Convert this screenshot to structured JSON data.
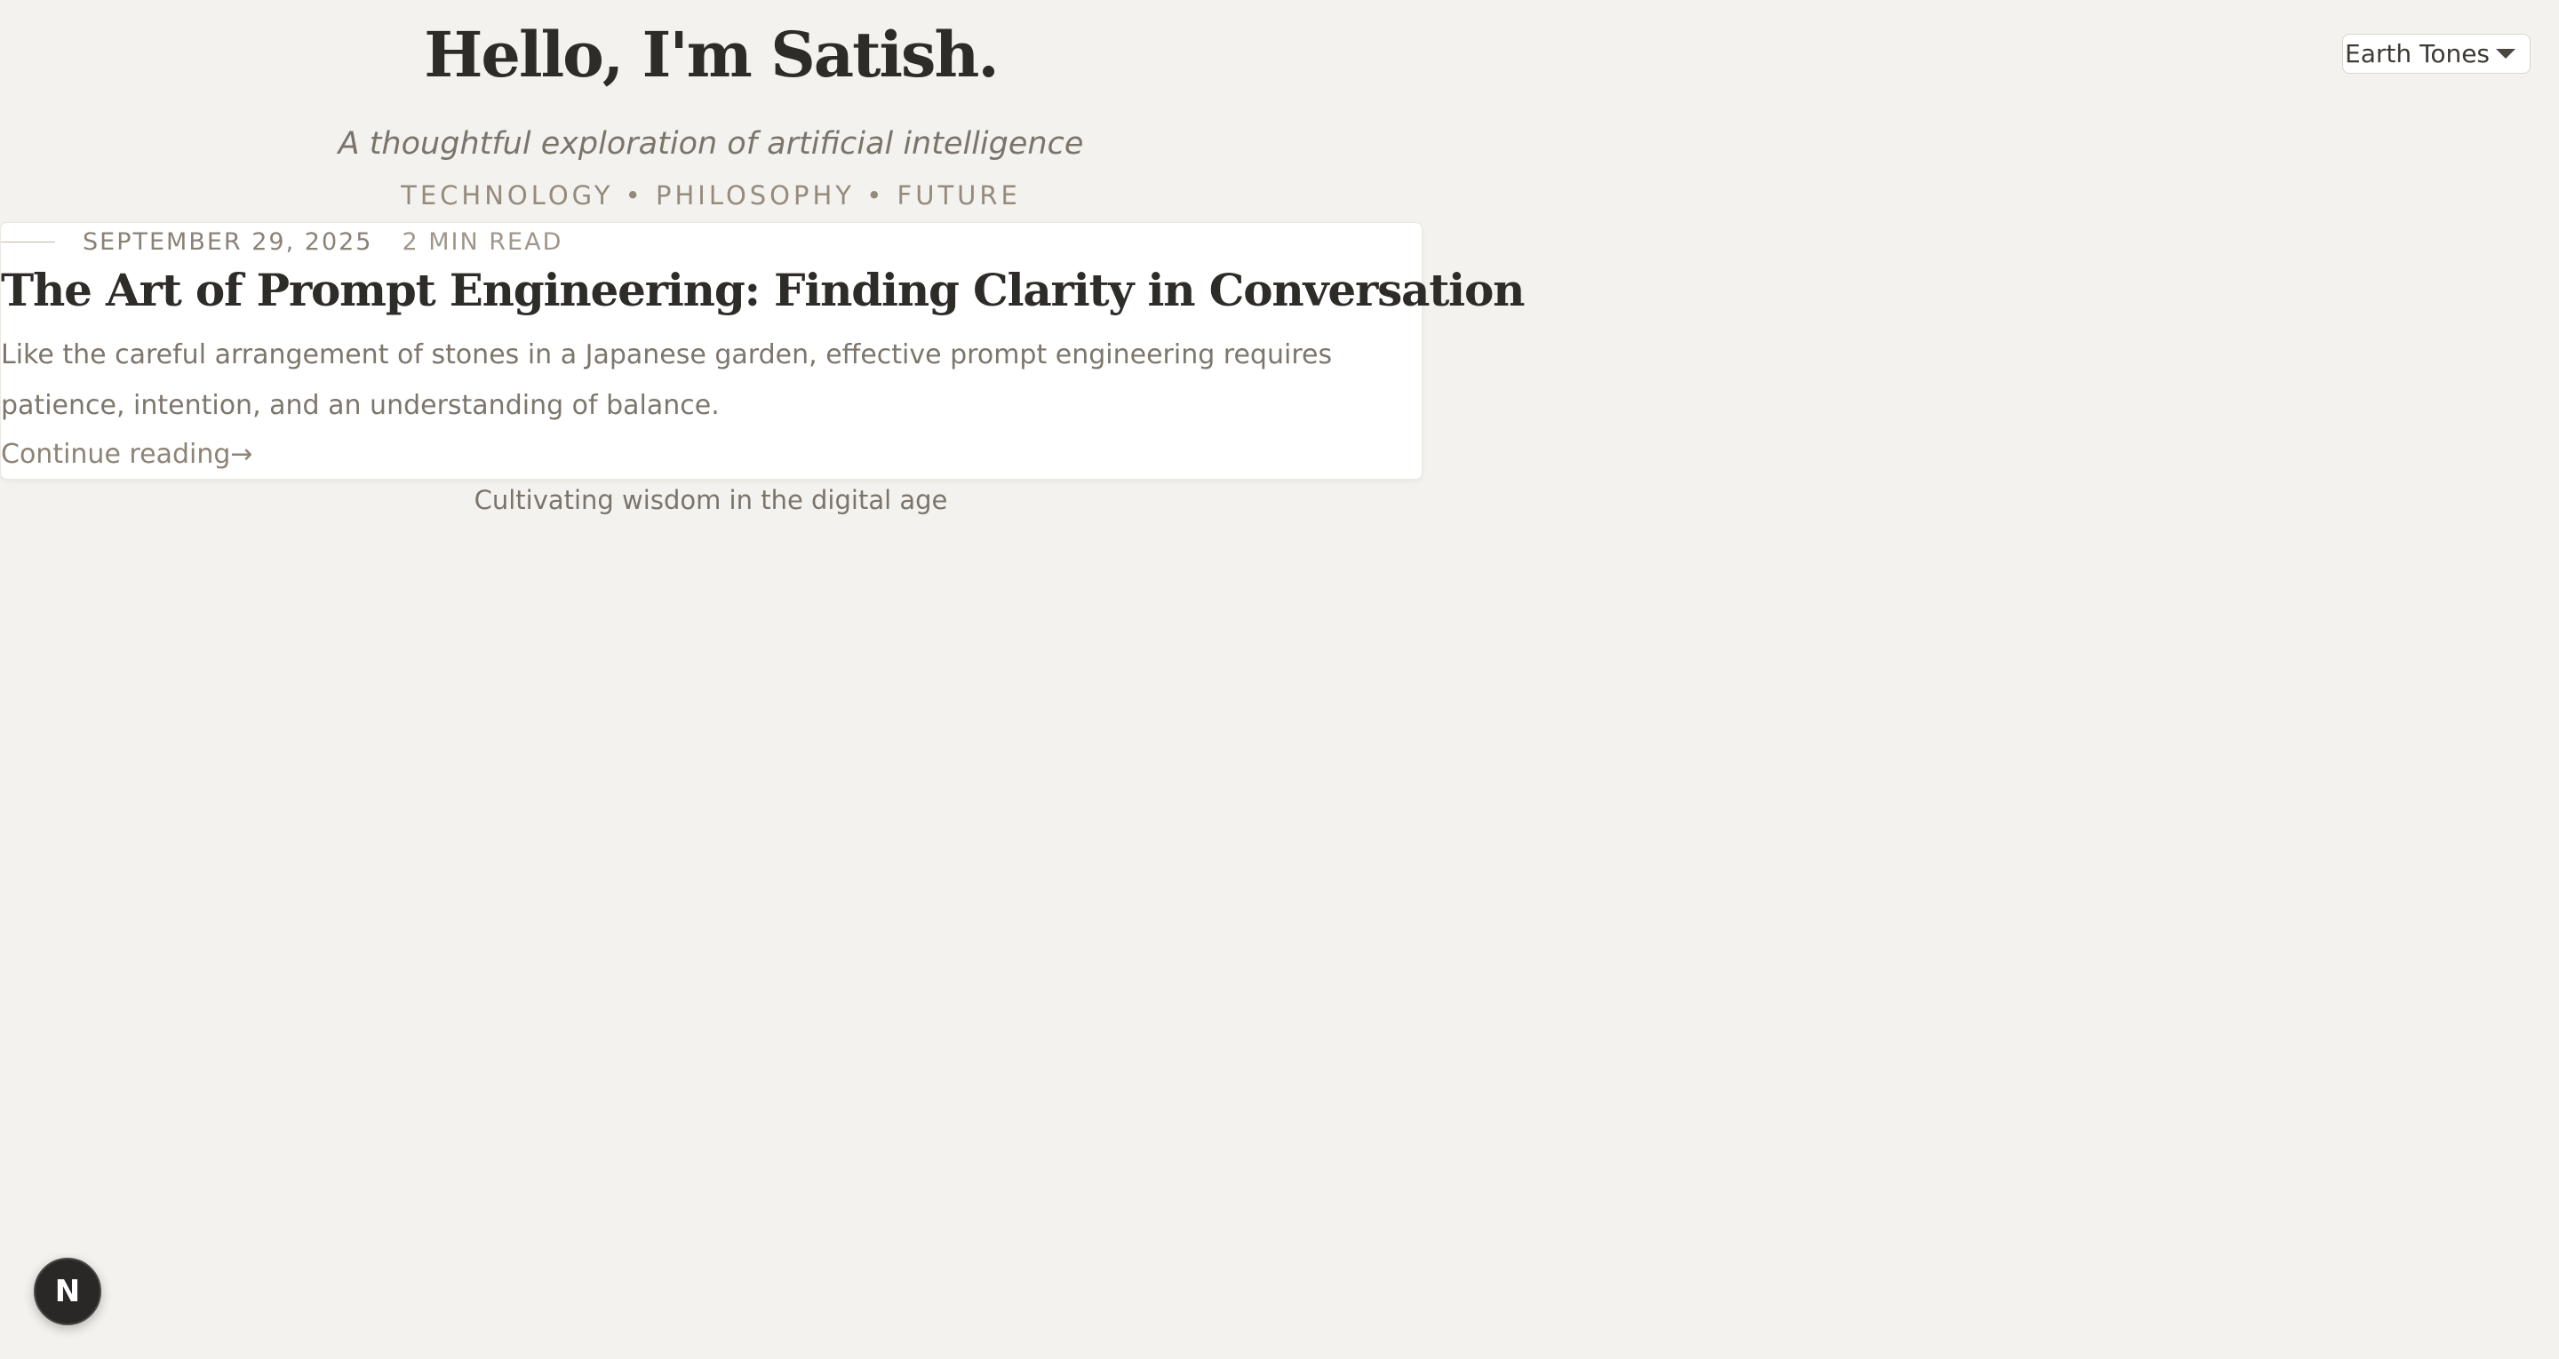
{
  "theme_selector": {
    "selected": "Earth Tones",
    "icon": "chevron-down-icon"
  },
  "header": {
    "title": "Hello, I'm Satish.",
    "tagline": "A thoughtful exploration of artificial intelligence",
    "topics": "TECHNOLOGY • PHILOSOPHY • FUTURE"
  },
  "post": {
    "date": "SEPTEMBER 29, 2025",
    "read_time": "2 MIN READ",
    "title": "The Art of Prompt Engineering: Finding Clarity in Conversation",
    "excerpt": "Like the careful arrangement of stones in a Japanese garden, effective prompt engineering requires patience, intention, and an understanding of balance.",
    "link_label": "Continue reading→"
  },
  "footer": {
    "text": "Cultivating wisdom in the digital age"
  },
  "dev_badge": {
    "glyph": "N",
    "icon": "nextjs-logo-icon"
  },
  "colors": {
    "background": "#f4f2ee",
    "card": "#ffffff",
    "text_dark": "#2e2c29",
    "text_muted": "#7d766d",
    "accent_muted": "#958b7d"
  }
}
